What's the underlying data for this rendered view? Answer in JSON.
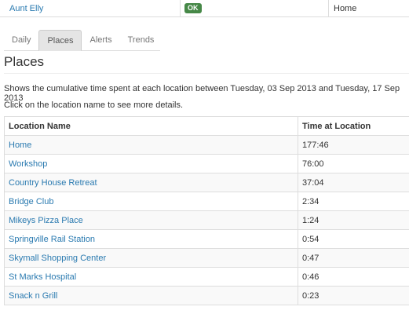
{
  "summary": {
    "person_name": "Aunt Elly",
    "status_badge": "OK",
    "location": "Home"
  },
  "tabs": [
    {
      "label": "Daily",
      "active": false
    },
    {
      "label": "Places",
      "active": true
    },
    {
      "label": "Alerts",
      "active": false
    },
    {
      "label": "Trends",
      "active": false
    }
  ],
  "page": {
    "title": "Places",
    "description": "Shows the cumulative time spent at each location between Tuesday, 03 Sep 2013 and Tuesday, 17 Sep 2013",
    "hint": "Click on the location name to see more details."
  },
  "table": {
    "headers": {
      "name": "Location Name",
      "time": "Time at Location"
    },
    "rows": [
      {
        "name": "Home",
        "time": "177:46"
      },
      {
        "name": "Workshop",
        "time": "76:00"
      },
      {
        "name": "Country House Retreat",
        "time": "37:04"
      },
      {
        "name": "Bridge Club",
        "time": "2:34"
      },
      {
        "name": "Mikeys Pizza Place",
        "time": "1:24"
      },
      {
        "name": "Springville Rail Station",
        "time": "0:54"
      },
      {
        "name": "Skymall Shopping Center",
        "time": "0:47"
      },
      {
        "name": "St Marks Hospital",
        "time": "0:46"
      },
      {
        "name": "Snack n Grill",
        "time": "0:23"
      }
    ]
  },
  "colors": {
    "link": "#2a7ab0",
    "ok_badge": "#468847"
  }
}
